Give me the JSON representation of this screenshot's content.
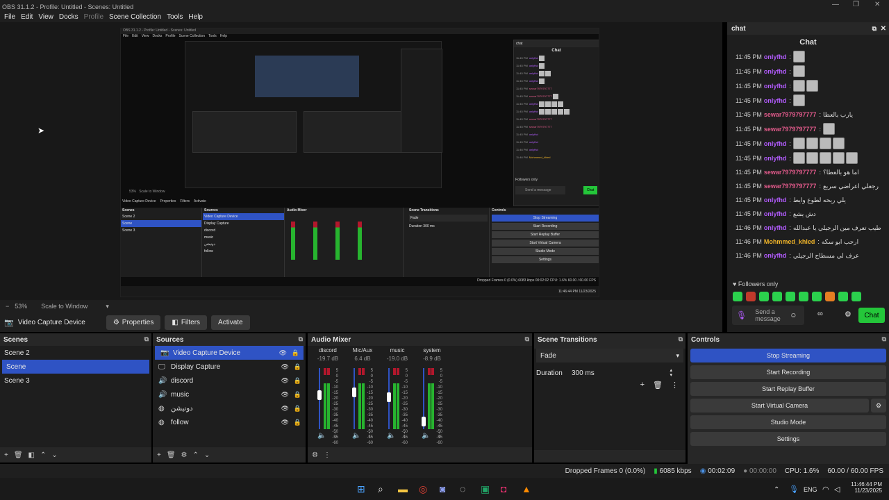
{
  "window": {
    "title": "OBS 31.1.2 - Profile: Untitled - Scenes: Untitled"
  },
  "menu": [
    "File",
    "Edit",
    "View",
    "Docks",
    "Profile",
    "Scene Collection",
    "Tools",
    "Help"
  ],
  "zoombar": {
    "minus": "−",
    "zoom": "53%",
    "scale": "Scale to Window"
  },
  "source_toolbar": {
    "source": "Video Capture Device",
    "properties": "Properties",
    "filters": "Filters",
    "activate": "Activate"
  },
  "chat": {
    "dock_title": "chat",
    "title": "Chat",
    "messages": [
      {
        "time": "11:45 PM",
        "user": "onlyfhd",
        "color": "#b35cff",
        "text": "",
        "emotes": 1
      },
      {
        "time": "11:45 PM",
        "user": "onlyfhd",
        "color": "#b35cff",
        "text": "",
        "emotes": 1
      },
      {
        "time": "11:45 PM",
        "user": "onlyfhd",
        "color": "#b35cff",
        "text": "",
        "emotes": 2
      },
      {
        "time": "11:45 PM",
        "user": "onlyfhd",
        "color": "#b35cff",
        "text": "",
        "emotes": 1
      },
      {
        "time": "11:45 PM",
        "user": "sewar7979797777",
        "color": "#e05a8a",
        "text": "يارب بالعطا",
        "emotes": 0
      },
      {
        "time": "11:45 PM",
        "user": "sewar7979797777",
        "color": "#e05a8a",
        "text": "",
        "emotes": 1
      },
      {
        "time": "11:45 PM",
        "user": "onlyfhd",
        "color": "#b35cff",
        "text": "",
        "emotes": 4
      },
      {
        "time": "11:45 PM",
        "user": "onlyfhd",
        "color": "#b35cff",
        "text": "",
        "emotes": 5
      },
      {
        "time": "11:45 PM",
        "user": "sewar7979797777",
        "color": "#e05a8a",
        "text": "اما هو بالعطا؟",
        "emotes": 0
      },
      {
        "time": "11:45 PM",
        "user": "sewar7979797777",
        "color": "#e05a8a",
        "text": "رجعلي اعراضي سريع",
        "emotes": 0
      },
      {
        "time": "11:45 PM",
        "user": "onlyfhd",
        "color": "#b35cff",
        "text": "يلي ريحه لطوع وايط",
        "emotes": 0
      },
      {
        "time": "11:45 PM",
        "user": "onlyfhd",
        "color": "#b35cff",
        "text": "دش يشع",
        "emotes": 0
      },
      {
        "time": "11:46 PM",
        "user": "onlyfhd",
        "color": "#b35cff",
        "text": "طيب تعرف مين الرجيلي يا عبدالله",
        "emotes": 0
      },
      {
        "time": "11:46 PM",
        "user": "Mohmmed_khled",
        "color": "#f0b429",
        "text": "ارحب ابو سكه",
        "emotes": 0
      },
      {
        "time": "11:46 PM",
        "user": "onlyfhd",
        "color": "#b35cff",
        "text": "عرف لي مسطاح الرجيلي",
        "emotes": 0
      }
    ],
    "followers_only": "Followers only",
    "input_placeholder": "Send a message",
    "send": "Chat"
  },
  "scenes": {
    "title": "Scenes",
    "items": [
      "Scene 2",
      "Scene",
      "Scene 3"
    ],
    "selected": 1
  },
  "sources": {
    "title": "Sources",
    "items": [
      {
        "name": "Video Capture Device",
        "icon": "camera-icon",
        "selected": true
      },
      {
        "name": "Display Capture",
        "icon": "monitor-icon"
      },
      {
        "name": "discord",
        "icon": "speaker-icon"
      },
      {
        "name": "music",
        "icon": "speaker-icon"
      },
      {
        "name": "دونيشن",
        "icon": "globe-icon"
      },
      {
        "name": "follow",
        "icon": "globe-icon"
      }
    ]
  },
  "mixer": {
    "title": "Audio Mixer",
    "channels": [
      {
        "name": "discord",
        "db": "-19.7 dB",
        "level": 0.55
      },
      {
        "name": "Mic/Aux",
        "db": "6.4 dB",
        "level": 0.6
      },
      {
        "name": "music",
        "db": "-19.0 dB",
        "level": 0.5
      },
      {
        "name": "system",
        "db": "-8.9 dB",
        "level": 0.0
      }
    ],
    "scale": [
      "5",
      "0",
      "-5",
      "-10",
      "-15",
      "-20",
      "-25",
      "-30",
      "-35",
      "-40",
      "-45",
      "-50",
      "-55",
      "-60"
    ]
  },
  "transitions": {
    "title": "Scene Transitions",
    "selected": "Fade",
    "duration_label": "Duration",
    "duration": "300 ms"
  },
  "controls": {
    "title": "Controls",
    "buttons": [
      "Stop Streaming",
      "Start Recording",
      "Start Replay Buffer",
      "Start Virtual Camera",
      "Studio Mode",
      "Settings"
    ]
  },
  "status": {
    "dropped": "Dropped Frames 0 (0.0%)",
    "kbps": "6085 kbps",
    "stream_time": "00:02:09",
    "rec_time": "00:00:00",
    "cpu": "CPU: 1.6%",
    "fps": "60.00 / 60.00 FPS"
  },
  "taskbar": {
    "lang": "ENG",
    "time": "11:46:44 PM",
    "date": "11/23/2025"
  },
  "nested": {
    "title": "OBS 31.1.2 - Profile: Untitled - Scenes: Untitled",
    "menu": [
      "File",
      "Edit",
      "View",
      "Docks",
      "Profile",
      "Scene Collection",
      "Tools",
      "Help"
    ],
    "zoom": "53%",
    "scale": "Scale to Window",
    "source": "Video Capture Device",
    "properties": "Properties",
    "filters": "Filters",
    "activate": "Activate",
    "scenes_title": "Scenes",
    "scenes": [
      "Scene 2",
      "Scene",
      "Scene 3"
    ],
    "sources_title": "Sources",
    "sources": [
      "Video Capture Device",
      "Display Capture",
      "discord",
      "music",
      "دونيشن",
      "follow"
    ],
    "mixer_title": "Audio Mixer",
    "transitions_title": "Scene Transitions",
    "fade": "Fade",
    "duration_label": "Duration",
    "duration": "300 ms",
    "controls_title": "Controls",
    "controls": [
      "Stop Streaming",
      "Start Recording",
      "Start Replay Buffer",
      "Start Virtual Camera",
      "Studio Mode",
      "Settings"
    ],
    "chat_title": "Chat",
    "chat": "chat",
    "followers": "Followers only",
    "send": "Send a message",
    "chat_btn": "Chat",
    "status": "Dropped Frames 0 (0.0%)   6083 kbps   00:02:02   CPU: 1.6%   60.00 / 60.00 FPS",
    "date": "11:46:44 PM 11/23/2025"
  }
}
